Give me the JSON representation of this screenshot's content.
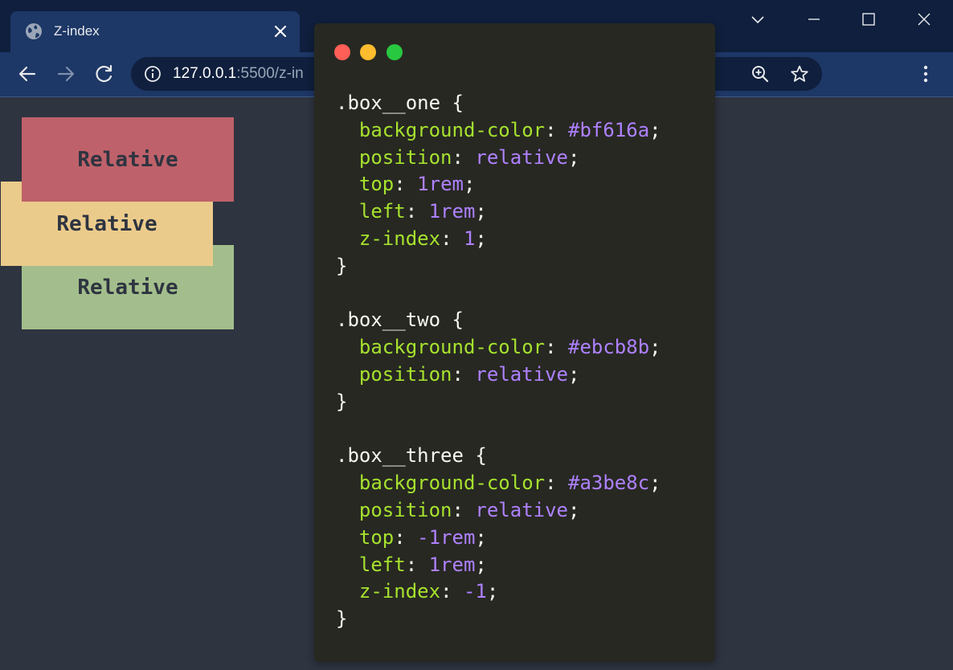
{
  "browser": {
    "tab_title": "Z-index",
    "url_host": "127.0.0.1",
    "url_rest": ":5500/z-in"
  },
  "page": {
    "box_one_label": "Relative",
    "box_two_label": "Relative",
    "box_three_label": "Relative"
  },
  "colors": {
    "box_one": "#bf616a",
    "box_two": "#ebcb8b",
    "box_three": "#a3be8c",
    "page_background": "#2e3440",
    "code_background": "#272822",
    "property": "#a6e22e",
    "value": "#ae81ff"
  },
  "code_lines": [
    [
      {
        "t": ".box__one {",
        "c": "txt"
      }
    ],
    [
      {
        "t": "  ",
        "c": "txt"
      },
      {
        "t": "background-color",
        "c": "prop"
      },
      {
        "t": ": ",
        "c": "txt"
      },
      {
        "t": "#bf616a",
        "c": "val"
      },
      {
        "t": ";",
        "c": "txt"
      }
    ],
    [
      {
        "t": "  ",
        "c": "txt"
      },
      {
        "t": "position",
        "c": "prop"
      },
      {
        "t": ": ",
        "c": "txt"
      },
      {
        "t": "relative",
        "c": "val"
      },
      {
        "t": ";",
        "c": "txt"
      }
    ],
    [
      {
        "t": "  ",
        "c": "txt"
      },
      {
        "t": "top",
        "c": "prop"
      },
      {
        "t": ": ",
        "c": "txt"
      },
      {
        "t": "1rem",
        "c": "val"
      },
      {
        "t": ";",
        "c": "txt"
      }
    ],
    [
      {
        "t": "  ",
        "c": "txt"
      },
      {
        "t": "left",
        "c": "prop"
      },
      {
        "t": ": ",
        "c": "txt"
      },
      {
        "t": "1rem",
        "c": "val"
      },
      {
        "t": ";",
        "c": "txt"
      }
    ],
    [
      {
        "t": "  ",
        "c": "txt"
      },
      {
        "t": "z-index",
        "c": "prop"
      },
      {
        "t": ": ",
        "c": "txt"
      },
      {
        "t": "1",
        "c": "val"
      },
      {
        "t": ";",
        "c": "txt"
      }
    ],
    [
      {
        "t": "}",
        "c": "txt"
      }
    ],
    [
      {
        "t": "",
        "c": "txt"
      }
    ],
    [
      {
        "t": ".box__two {",
        "c": "txt"
      }
    ],
    [
      {
        "t": "  ",
        "c": "txt"
      },
      {
        "t": "background-color",
        "c": "prop"
      },
      {
        "t": ": ",
        "c": "txt"
      },
      {
        "t": "#ebcb8b",
        "c": "val"
      },
      {
        "t": ";",
        "c": "txt"
      }
    ],
    [
      {
        "t": "  ",
        "c": "txt"
      },
      {
        "t": "position",
        "c": "prop"
      },
      {
        "t": ": ",
        "c": "txt"
      },
      {
        "t": "relative",
        "c": "val"
      },
      {
        "t": ";",
        "c": "txt"
      }
    ],
    [
      {
        "t": "}",
        "c": "txt"
      }
    ],
    [
      {
        "t": "",
        "c": "txt"
      }
    ],
    [
      {
        "t": ".box__three {",
        "c": "txt"
      }
    ],
    [
      {
        "t": "  ",
        "c": "txt"
      },
      {
        "t": "background-color",
        "c": "prop"
      },
      {
        "t": ": ",
        "c": "txt"
      },
      {
        "t": "#a3be8c",
        "c": "val"
      },
      {
        "t": ";",
        "c": "txt"
      }
    ],
    [
      {
        "t": "  ",
        "c": "txt"
      },
      {
        "t": "position",
        "c": "prop"
      },
      {
        "t": ": ",
        "c": "txt"
      },
      {
        "t": "relative",
        "c": "val"
      },
      {
        "t": ";",
        "c": "txt"
      }
    ],
    [
      {
        "t": "  ",
        "c": "txt"
      },
      {
        "t": "top",
        "c": "prop"
      },
      {
        "t": ": ",
        "c": "txt"
      },
      {
        "t": "-1rem",
        "c": "val"
      },
      {
        "t": ";",
        "c": "txt"
      }
    ],
    [
      {
        "t": "  ",
        "c": "txt"
      },
      {
        "t": "left",
        "c": "prop"
      },
      {
        "t": ": ",
        "c": "txt"
      },
      {
        "t": "1rem",
        "c": "val"
      },
      {
        "t": ";",
        "c": "txt"
      }
    ],
    [
      {
        "t": "  ",
        "c": "txt"
      },
      {
        "t": "z-index",
        "c": "prop"
      },
      {
        "t": ": ",
        "c": "txt"
      },
      {
        "t": "-1",
        "c": "val"
      },
      {
        "t": ";",
        "c": "txt"
      }
    ],
    [
      {
        "t": "}",
        "c": "txt"
      }
    ]
  ]
}
